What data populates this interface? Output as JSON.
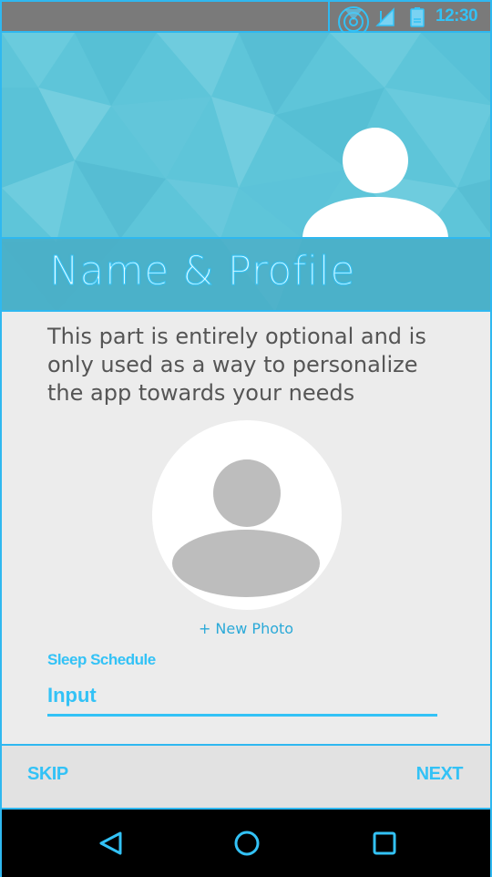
{
  "status_bar": {
    "time": "12:30",
    "icons": [
      "wifi-icon",
      "signal-icon",
      "battery-icon"
    ]
  },
  "header": {
    "title": "Name & Profile",
    "avatar_icon": "person-icon"
  },
  "content": {
    "intro_text": "This part is entirely optional and is only used as a way to personalize the app towards your needs",
    "photo_icon": "person-icon",
    "new_photo_label": "+ New Photo",
    "field_label": "Sleep Schedule",
    "field_placeholder": "Input"
  },
  "footer": {
    "skip_label": "SKIP",
    "next_label": "NEXT"
  },
  "nav_bar": {
    "icons": [
      "back-icon",
      "home-icon",
      "recents-icon"
    ]
  },
  "colors": {
    "accent": "#33C2F6",
    "header_background": "#5EC5D9",
    "content_background": "#ECECEC",
    "status_bar_background": "#7A7A7A"
  }
}
